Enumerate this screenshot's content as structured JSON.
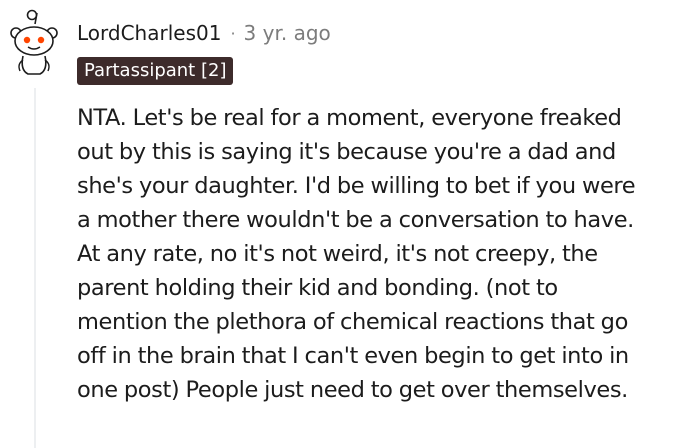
{
  "comment": {
    "author": "LordCharles01",
    "separator": "·",
    "timestamp": "3 yr. ago",
    "flair": "Partassipant [2]",
    "avatar_icon": "reddit-snoo-avatar-icon",
    "body_lines": [
      "NTA. Let's be real for a moment, everyone freaked",
      "out by this is saying it's because you're a dad and",
      "she's your daughter. I'd be willing to bet if you were",
      "a mother there wouldn't be a conversation to have.",
      "At any rate, no it's not weird, it's not creepy, the",
      "parent holding their kid and bonding. (not to",
      "mention the plethora of chemical reactions that go",
      "off in the brain that I can't even begin to get into in",
      "one post) People just need to get over themselves."
    ]
  },
  "colors": {
    "flair_bg": "#3d2b2b",
    "meta_text": "#7c7c7c",
    "snoo_eye": "#ff4500",
    "thread_line": "#edeff1"
  }
}
